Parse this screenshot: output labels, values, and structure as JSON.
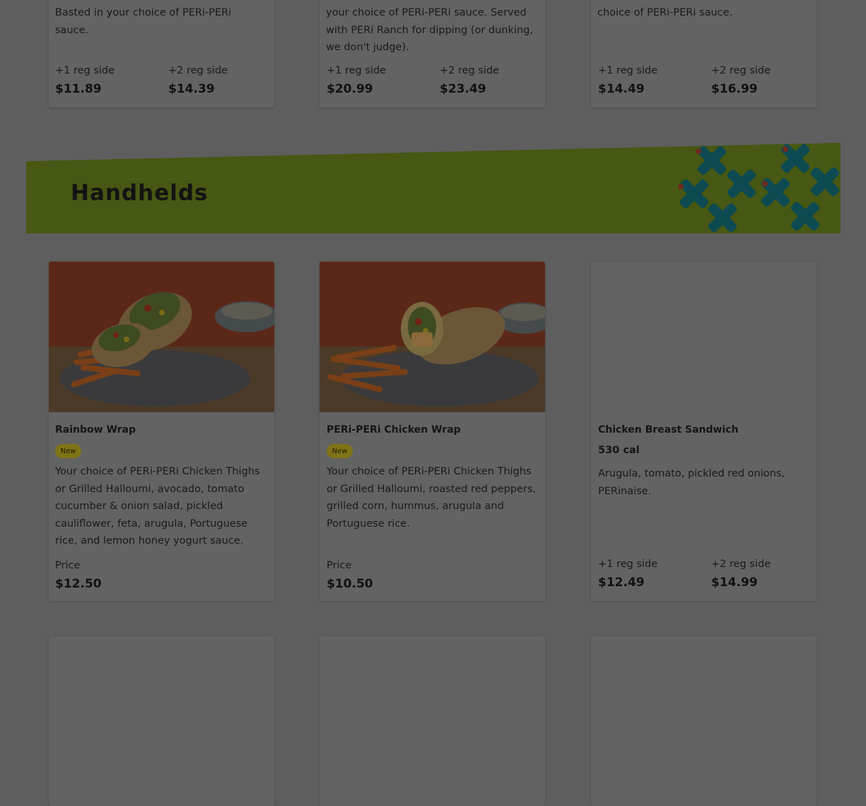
{
  "top_cards": [
    {
      "desc": "Basted in your choice of PERi-PERi sauce.",
      "opt1_label": "+1 reg side",
      "opt1_price": "$11.89",
      "opt2_label": "+2 reg side",
      "opt2_price": "$14.39"
    },
    {
      "desc": "your choice of PERi-PERi sauce. Served with PERi Ranch for dipping (or dunking, we don't judge).",
      "opt1_label": "+1 reg side",
      "opt1_price": "$20.99",
      "opt2_label": "+2 reg side",
      "opt2_price": "$23.49"
    },
    {
      "desc": "choice of PERi-PERi sauce.",
      "opt1_label": "+1 reg side",
      "opt1_price": "$14.49",
      "opt2_label": "+2 reg side",
      "opt2_price": "$16.99"
    }
  ],
  "section": {
    "title": "Handhelds",
    "banner_color": "#465813",
    "pattern_color": "#0d4a52"
  },
  "items": [
    {
      "name": "Rainbow Wrap",
      "badge": "New",
      "desc": "Your choice of PERi-PERi Chicken Thighs or Grilled Halloumi, avocado, tomato cucumber & onion salad, pickled cauliflower, feta, arugula, Portuguese rice, and lemon honey yogurt sauce.",
      "price_label": "Price",
      "price": "$12.50"
    },
    {
      "name": "PERi-PERi Chicken Wrap",
      "badge": "New",
      "desc": "Your choice of PERi-PERi Chicken Thighs or Grilled Halloumi, roasted red peppers, grilled corn, hummus, arugula and Portuguese rice.",
      "price_label": "Price",
      "price": "$10.50"
    },
    {
      "name": "Chicken Breast Sandwich",
      "calories": "530 cal",
      "desc": "Arugula, tomato, pickled red onions, PERinaise.",
      "opt1_label": "+1 reg side",
      "opt1_price": "$12.49",
      "opt2_label": "+2 reg side",
      "opt2_price": "$14.99"
    }
  ]
}
